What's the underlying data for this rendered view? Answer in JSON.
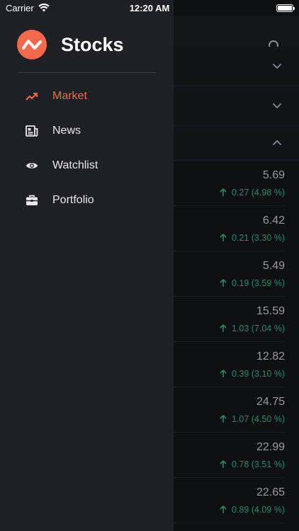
{
  "status_bar": {
    "carrier": "Carrier",
    "time": "12:20 AM"
  },
  "drawer": {
    "app_title": "Stocks",
    "menu": [
      {
        "label": "Market",
        "icon": "trending-up-icon",
        "active": true
      },
      {
        "label": "News",
        "icon": "newspaper-icon",
        "active": false
      },
      {
        "label": "Watchlist",
        "icon": "eye-icon",
        "active": false
      },
      {
        "label": "Portfolio",
        "icon": "briefcase-icon",
        "active": false
      }
    ]
  },
  "background": {
    "rows": [
      {
        "price": "5.69",
        "change": "0.27 (4.98 %)"
      },
      {
        "price": "6.42",
        "change": "0.21 (3.30 %)"
      },
      {
        "price": "5.49",
        "change": "0.19 (3.59 %)"
      },
      {
        "price": "15.59",
        "change": "1.03 (7.04 %)"
      },
      {
        "price": "12.82",
        "change": "0.39 (3.10 %)"
      },
      {
        "price": "24.75",
        "change": "1.07 (4.50 %)"
      },
      {
        "price": "22.99",
        "change": "0.78 (3.51 %)"
      },
      {
        "price": "22.65",
        "change": "0.89 (4.09 %)"
      }
    ]
  },
  "colors": {
    "accent": "#f26a4b",
    "positive": "#1f8f63",
    "drawer_bg": "#1f2026"
  }
}
